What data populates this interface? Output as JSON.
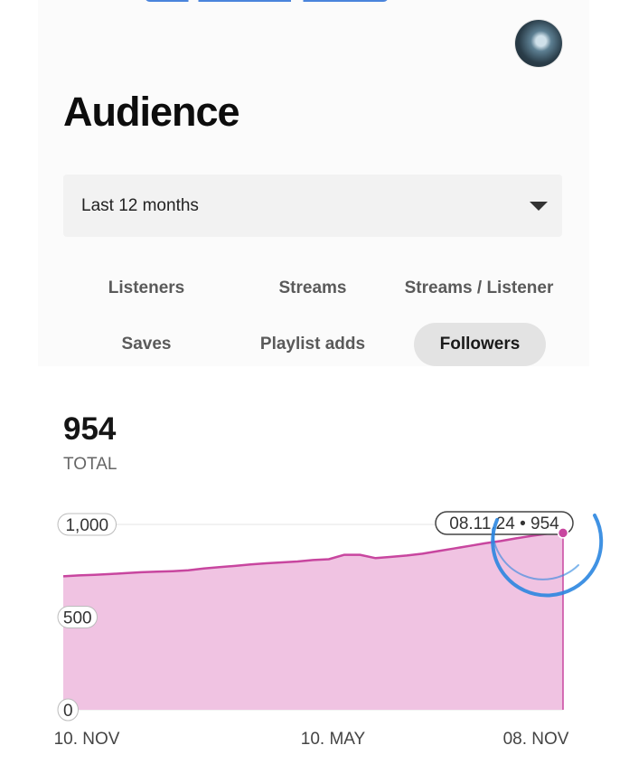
{
  "header": {
    "title": "Audience"
  },
  "period_select": {
    "selected": "Last 12 months"
  },
  "tabs": [
    {
      "label": "Listeners",
      "active": false
    },
    {
      "label": "Streams",
      "active": false
    },
    {
      "label": "Streams / Listener",
      "active": false
    },
    {
      "label": "Saves",
      "active": false
    },
    {
      "label": "Playlist adds",
      "active": false
    },
    {
      "label": "Followers",
      "active": true
    }
  ],
  "summary": {
    "value": "954",
    "label": "TOTAL"
  },
  "colors": {
    "area_fill": "#f0c3e2",
    "line": "#c8469f",
    "highlight_ring": "#2b86e0"
  },
  "chart_data": {
    "type": "area",
    "x": [
      "10. NOV",
      "10. MAY",
      "08. NOV"
    ],
    "ylim": [
      0,
      1000
    ],
    "yticks": [
      "0",
      "500",
      "1,000"
    ],
    "xticks": [
      "10. NOV",
      "10. MAY",
      "08. NOV"
    ],
    "grid": true,
    "series": [
      {
        "values": [
          720,
          725,
          728,
          732,
          737,
          742,
          745,
          748,
          752,
          762,
          770,
          776,
          784,
          790,
          795,
          800,
          808,
          812,
          836,
          836,
          818,
          825,
          832,
          842,
          856,
          870,
          884,
          898,
          910,
          925,
          938,
          950,
          954
        ]
      }
    ],
    "tooltip": {
      "date": "08.11.24",
      "value": "954",
      "text": "08.11.24 • 954"
    }
  }
}
